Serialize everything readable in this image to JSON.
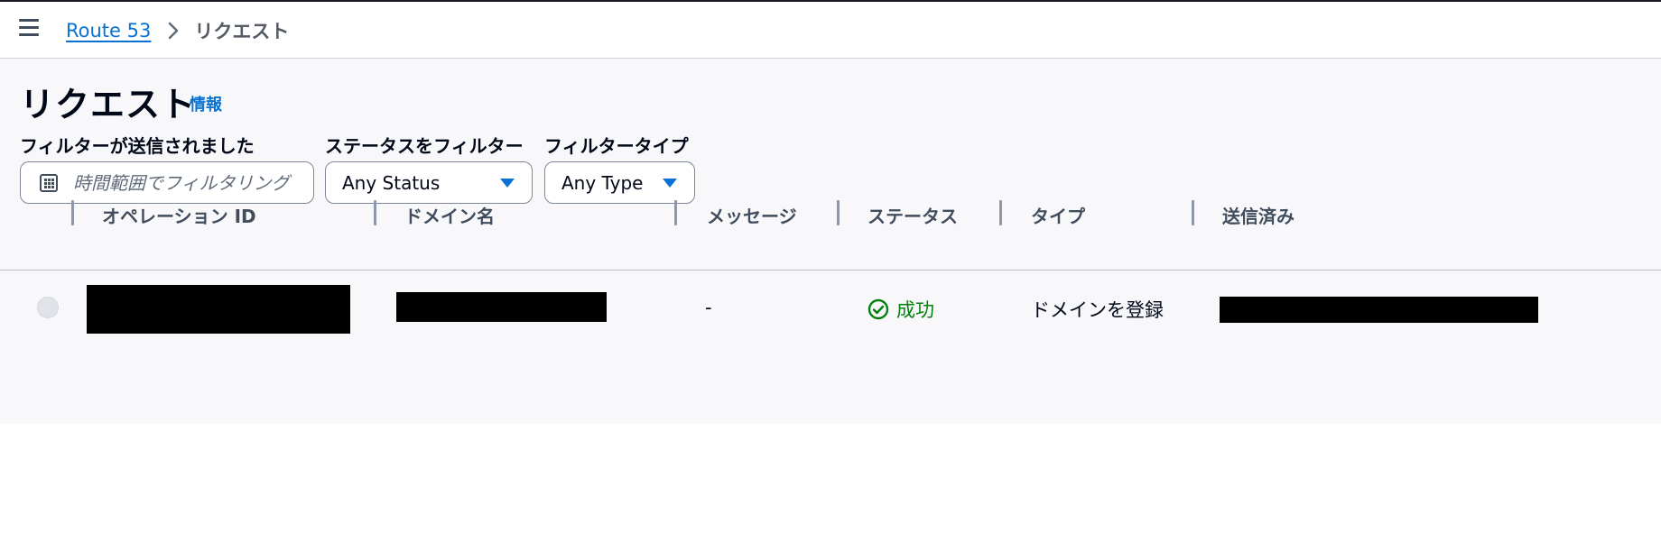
{
  "header": {
    "menu_icon": "hamburger-menu-icon",
    "breadcrumbs": [
      "Route 53",
      "リクエスト"
    ]
  },
  "page": {
    "title": "リクエスト",
    "info_link": "情報"
  },
  "filters": {
    "submitted": {
      "label": "フィルターが送信されました",
      "placeholder": "時間範囲でフィルタリング",
      "icon": "calendar-icon"
    },
    "status": {
      "label": "ステータスをフィルター",
      "value": "Any Status"
    },
    "type": {
      "label": "フィルタータイプ",
      "value": "Any Type"
    }
  },
  "table": {
    "columns": [
      "オペレーション ID",
      "ドメイン名",
      "メッセージ",
      "ステータス",
      "タイプ",
      "送信済み"
    ],
    "rows": [
      {
        "operation_id": "",
        "domain": "",
        "message": "-",
        "status": "成功",
        "status_color": "#037f0c",
        "type": "ドメインを登録",
        "submitted": ""
      }
    ]
  },
  "colors": {
    "link": "#0972d3",
    "success": "#037f0c",
    "page_background": "#f8f8fb"
  }
}
